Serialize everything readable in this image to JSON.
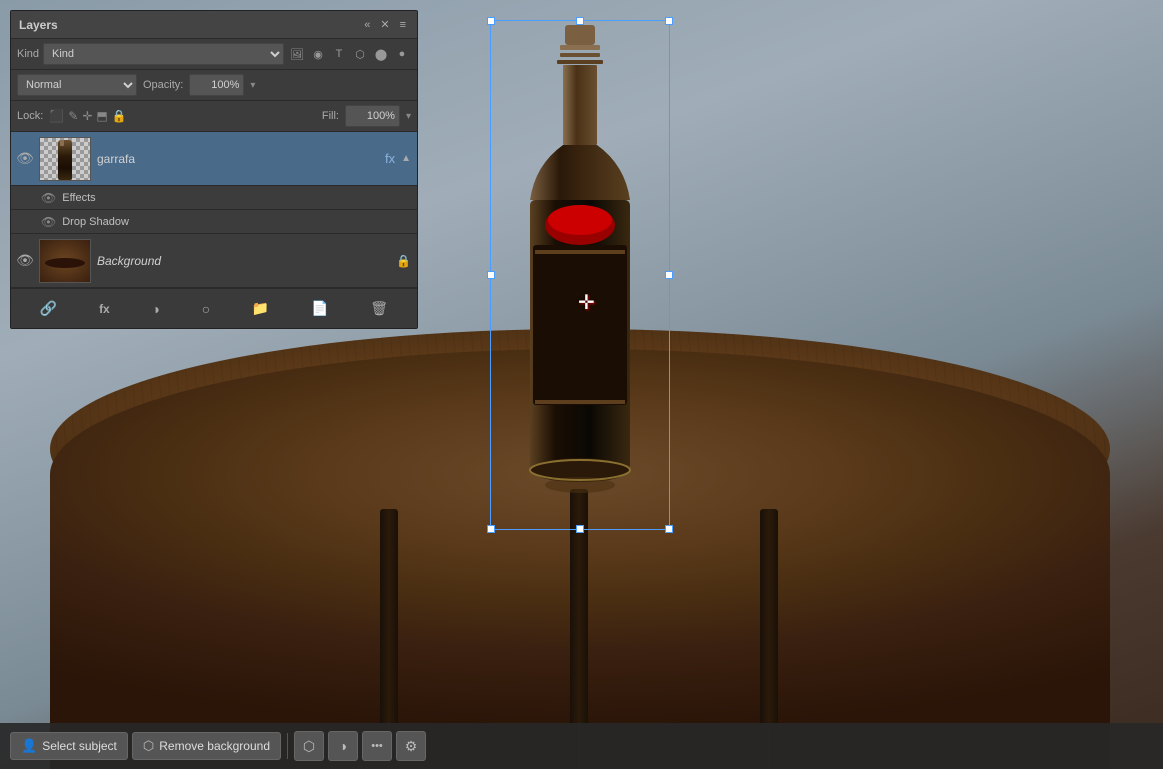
{
  "panel": {
    "title": "Layers",
    "menu_icon": "≡",
    "collapse_icon": "«",
    "close_icon": "✕"
  },
  "filter": {
    "label": "Kind",
    "kind_value": "Kind",
    "icons": [
      "image",
      "gradient",
      "text",
      "shape",
      "adjustment",
      "dot"
    ]
  },
  "blend": {
    "mode": "Normal",
    "opacity_label": "Opacity:",
    "opacity_value": "100%",
    "opacity_arrow": "▾"
  },
  "lock": {
    "label": "Lock:",
    "fill_label": "Fill:",
    "fill_value": "100%",
    "fill_arrow": "▾"
  },
  "layers": [
    {
      "name": "garrafa",
      "visible": true,
      "active": true,
      "italic": false,
      "has_fx": true,
      "locked": false,
      "effects": [
        {
          "name": "Effects",
          "visible": true
        },
        {
          "name": "Drop Shadow",
          "visible": true
        }
      ]
    },
    {
      "name": "Background",
      "visible": true,
      "active": false,
      "italic": true,
      "has_fx": false,
      "locked": true
    }
  ],
  "bottom_toolbar": {
    "link_icon": "🔗",
    "fx_label": "fx",
    "new_fill_icon": "◑",
    "mask_icon": "○",
    "group_icon": "📁",
    "new_layer_icon": "□",
    "delete_icon": "🗑"
  },
  "bottombar": {
    "select_subject_label": "Select subject",
    "remove_bg_label": "Remove background",
    "select_icon": "⬡",
    "circle_icon": "◑",
    "dots_icon": "•••",
    "settings_icon": "⚙"
  }
}
